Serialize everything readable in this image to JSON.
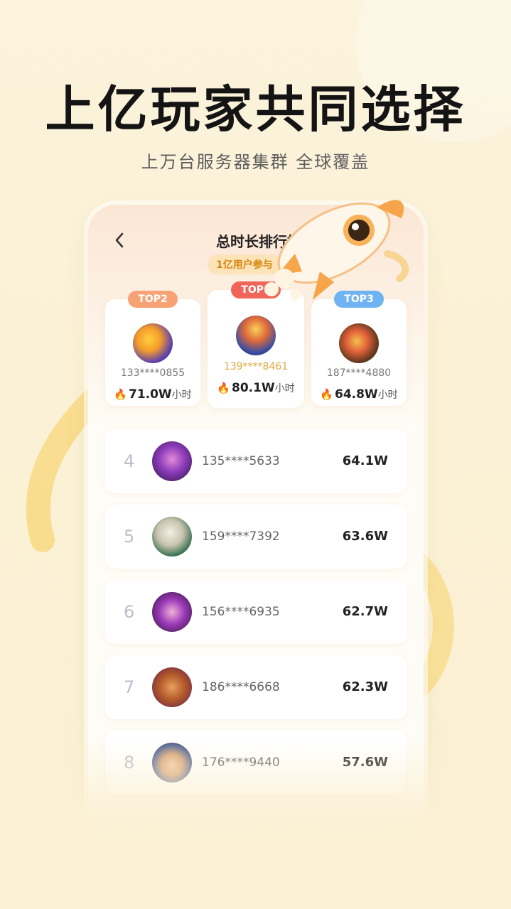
{
  "headline": "上亿玩家共同选择",
  "subline": "上万台服务器集群 全球覆盖",
  "screen": {
    "title": "总时长排行榜",
    "badge": "1亿用户参与",
    "back_icon": "chevron-left-icon"
  },
  "podium": [
    {
      "tag": "TOP2",
      "tag_color": "#f7a274",
      "id": "133****0855",
      "value": "71.0W",
      "unit": "小时"
    },
    {
      "tag": "TOP1",
      "tag_color": "#f0645a",
      "id": "139****8461",
      "value": "80.1W",
      "unit": "小时"
    },
    {
      "tag": "TOP3",
      "tag_color": "#6fb3f2",
      "id": "187****4880",
      "value": "64.8W",
      "unit": "小时"
    }
  ],
  "rankings": [
    {
      "rank": "4",
      "id": "135****5633",
      "value": "64.1W"
    },
    {
      "rank": "5",
      "id": "159****7392",
      "value": "63.6W"
    },
    {
      "rank": "6",
      "id": "156****6935",
      "value": "62.7W"
    },
    {
      "rank": "7",
      "id": "186****6668",
      "value": "62.3W"
    },
    {
      "rank": "8",
      "id": "176****9440",
      "value": "57.6W"
    }
  ],
  "colors": {
    "accent": "#f5b93a",
    "fire": "#f26b3a",
    "id_top1": "#e2a73a"
  }
}
